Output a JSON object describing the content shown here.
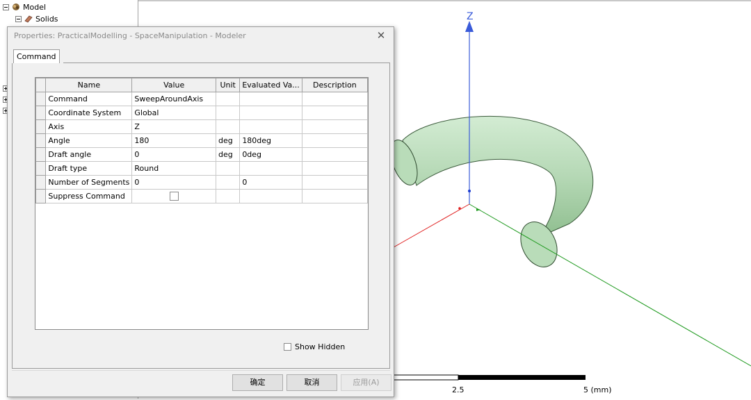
{
  "tree": {
    "model_label": "Model",
    "solids_label": "Solids"
  },
  "viewport": {
    "axis_label_z": "Z",
    "scale_tick_mid": "2.5",
    "scale_tick_end": "5 (mm)",
    "colors": {
      "z_axis": "#3a5bd9",
      "x_axis": "#e02020",
      "y_axis": "#1f9a1f",
      "torus_fill": "#b9dcb9",
      "torus_edge": "#2f4a2f"
    }
  },
  "dialog": {
    "title": "Properties: PracticalModelling - SpaceManipulation - Modeler",
    "close_icon": "close-icon",
    "tab_label": "Command",
    "columns": [
      "Name",
      "Value",
      "Unit",
      "Evaluated Va...",
      "Description"
    ],
    "rows": [
      {
        "name": "Command",
        "value": "SweepAroundAxis",
        "unit": "",
        "evaluated": "",
        "description": ""
      },
      {
        "name": "Coordinate System",
        "value": "Global",
        "unit": "",
        "evaluated": "",
        "description": ""
      },
      {
        "name": "Axis",
        "value": "Z",
        "unit": "",
        "evaluated": "",
        "description": ""
      },
      {
        "name": "Angle",
        "value": "180",
        "unit": "deg",
        "evaluated": "180deg",
        "description": ""
      },
      {
        "name": "Draft angle",
        "value": "0",
        "unit": "deg",
        "evaluated": "0deg",
        "description": ""
      },
      {
        "name": "Draft type",
        "value": "Round",
        "unit": "",
        "evaluated": "",
        "description": ""
      },
      {
        "name": "Number of Segments",
        "value": "0",
        "unit": "",
        "evaluated": "0",
        "description": ""
      },
      {
        "name": "Suppress Command",
        "value": "",
        "unit": "",
        "evaluated": "",
        "description": ""
      }
    ],
    "suppress_checked": false,
    "show_hidden_label": "Show Hidden",
    "show_hidden_checked": false,
    "buttons": {
      "ok": "确定",
      "cancel": "取消",
      "apply": "应用(A)"
    }
  }
}
